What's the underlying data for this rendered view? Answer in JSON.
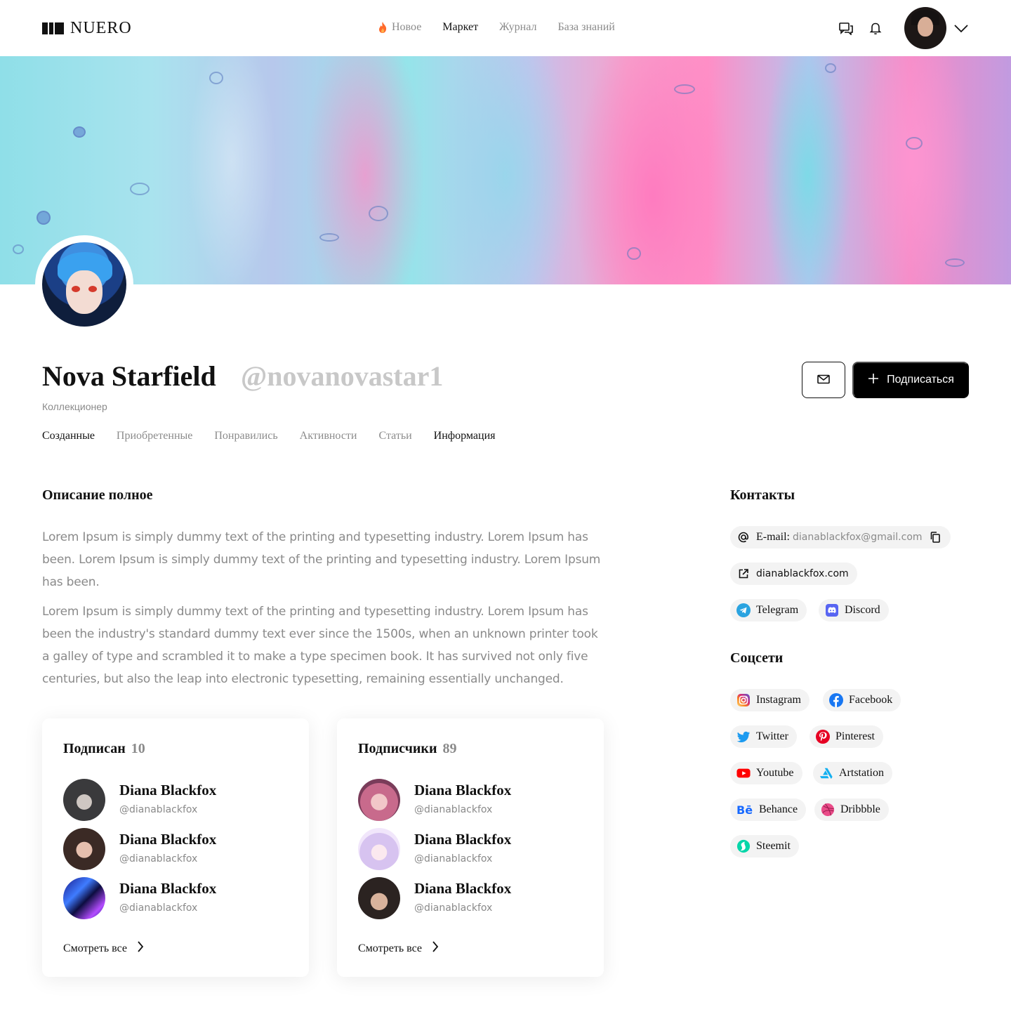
{
  "header": {
    "logo_text": "NUERO",
    "nav": [
      {
        "label": "Новое",
        "active": false,
        "icon": "flame-icon"
      },
      {
        "label": "Маркет",
        "active": true
      },
      {
        "label": "Журнал",
        "active": false
      },
      {
        "label": "База знаний",
        "active": false
      }
    ]
  },
  "profile": {
    "name": "Nova Starfield",
    "handle": "@novanovastar1",
    "role": "Коллекционер",
    "subscribe_label": "Подписаться"
  },
  "tabs": [
    "Созданные",
    "Приобретенные",
    "Понравились",
    "Активности",
    "Статьи",
    "Информация"
  ],
  "active_tab": "Информация",
  "description": {
    "title": "Описание полное",
    "paragraphs": [
      "Lorem Ipsum is simply dummy text of the printing and typesetting industry. Lorem Ipsum has been. Lorem Ipsum is simply dummy text of the printing and typesetting industry. Lorem Ipsum has been.",
      "Lorem Ipsum is simply dummy text of the printing and typesetting industry. Lorem Ipsum has been the industry's standard dummy text ever since the 1500s, when an unknown printer took a galley of type and scrambled it to make a type specimen book. It has survived not only five centuries, but also the leap into electronic typesetting, remaining essentially unchanged."
    ]
  },
  "following": {
    "title": "Подписан",
    "count": "10",
    "people": [
      {
        "name": "Diana Blackfox",
        "handle": "@dianablackfox"
      },
      {
        "name": "Diana Blackfox",
        "handle": "@dianablackfox"
      },
      {
        "name": "Diana Blackfox",
        "handle": "@dianablackfox"
      }
    ],
    "see_all": "Смотреть все"
  },
  "followers": {
    "title": "Подписчики",
    "count": "89",
    "people": [
      {
        "name": "Diana Blackfox",
        "handle": "@dianablackfox"
      },
      {
        "name": "Diana Blackfox",
        "handle": "@dianablackfox"
      },
      {
        "name": "Diana Blackfox",
        "handle": "@dianablackfox"
      }
    ],
    "see_all": "Смотреть все"
  },
  "contacts": {
    "title": "Контакты",
    "email_label": "E-mail:",
    "email": "dianablackfox@gmail.com",
    "website": "dianablackfox.com",
    "telegram": "Telegram",
    "discord": "Discord"
  },
  "socials": {
    "title": "Соцсети",
    "items": [
      "Instagram",
      "Facebook",
      "Twitter",
      "Pinterest",
      "Youtube",
      "Artstation",
      "Behance",
      "Dribbble",
      "Steemit"
    ]
  },
  "colors": {
    "accent": "#000000",
    "muted_text": "#8a8a8a",
    "handle": "#c8c8c8",
    "chip_bg": "#f3f3f3"
  }
}
